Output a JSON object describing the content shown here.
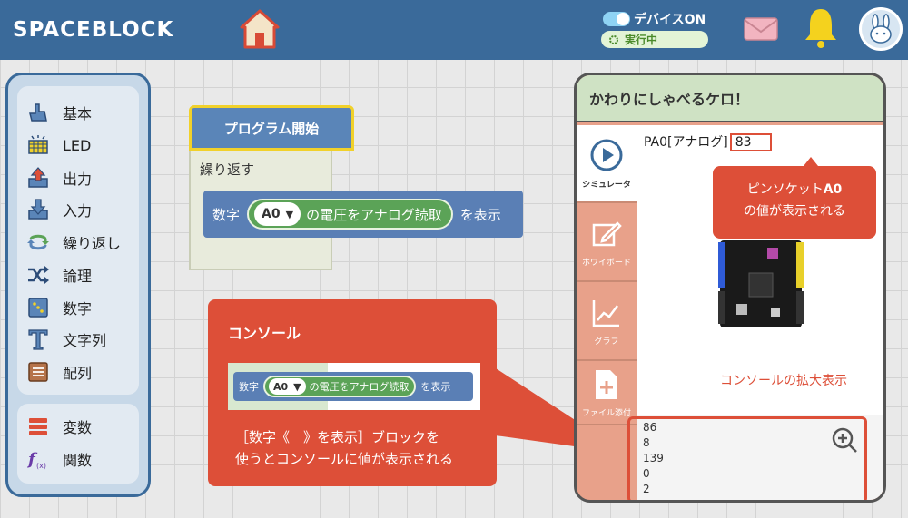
{
  "header": {
    "logo": "SPACEBLOCK",
    "device_label": "デバイスON",
    "status_label": "実行中"
  },
  "categories": {
    "group1": [
      {
        "label": "基本",
        "icon": "hand-icon"
      },
      {
        "label": "LED",
        "icon": "led-icon"
      },
      {
        "label": "出力",
        "icon": "output-icon"
      },
      {
        "label": "入力",
        "icon": "input-icon"
      },
      {
        "label": "繰り返し",
        "icon": "loop-icon"
      },
      {
        "label": "論理",
        "icon": "logic-icon"
      },
      {
        "label": "数字",
        "icon": "number-icon"
      },
      {
        "label": "文字列",
        "icon": "text-icon"
      },
      {
        "label": "配列",
        "icon": "array-icon"
      }
    ],
    "group2": [
      {
        "label": "変数",
        "icon": "variable-icon"
      },
      {
        "label": "関数",
        "icon": "function-icon"
      }
    ]
  },
  "blocks": {
    "start_label": "プログラム開始",
    "repeat_label": "繰り返す",
    "number_label": "数字",
    "dropdown_value": "A0",
    "voltage_label": "の電圧をアナログ読取",
    "display_label": "を表示"
  },
  "console_callout": {
    "title": "コンソール",
    "desc_line1": "［数字《　》を表示］ブロックを",
    "desc_line2": "使うとコンソールに値が表示される"
  },
  "right_panel": {
    "title": "かわりにしゃべるケロ！",
    "tabs": [
      {
        "label": "シミュレータ"
      },
      {
        "label": "ホワイボード"
      },
      {
        "label": "グラフ"
      },
      {
        "label": "ファイル添付"
      }
    ],
    "pin_label": "PA0[アナログ]",
    "pin_value": "83",
    "pin_callout_line1": "ピンソケット",
    "pin_callout_bold": "A0",
    "pin_callout_line2": "の値が表示される",
    "zoom_label": "コンソールの拡大表示",
    "console_lines": [
      "86",
      "8",
      "139",
      "0",
      "2"
    ]
  },
  "colors": {
    "header": "#3a6a9a",
    "accent_red": "#dd4f38",
    "block_blue": "#5a7fb5",
    "block_green": "#5ba357",
    "highlight_yellow": "#f1d12a"
  }
}
